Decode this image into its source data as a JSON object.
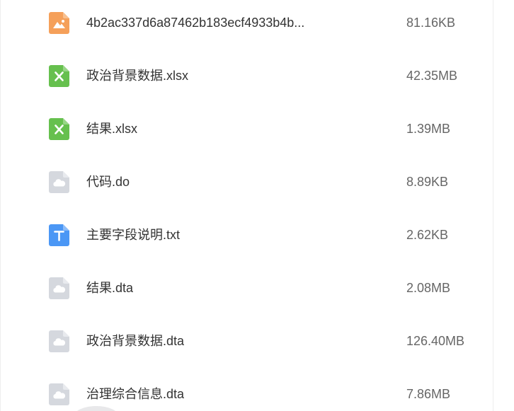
{
  "files": [
    {
      "name": "4b2ac337d6a87462b183ecf4933b4b...",
      "size": "81.16KB",
      "icon": "image-file-icon",
      "icon_color": "#F5A05A"
    },
    {
      "name": "政治背景数据.xlsx",
      "size": "42.35MB",
      "icon": "excel-file-icon",
      "icon_color": "#66C04E"
    },
    {
      "name": "结果.xlsx",
      "size": "1.39MB",
      "icon": "excel-file-icon",
      "icon_color": "#66C04E"
    },
    {
      "name": "代码.do",
      "size": "8.89KB",
      "icon": "unknown-file-icon",
      "icon_color": "#D5D8DE"
    },
    {
      "name": "主要字段说明.txt",
      "size": "2.62KB",
      "icon": "text-file-icon",
      "icon_color": "#4B97F5"
    },
    {
      "name": "结果.dta",
      "size": "2.08MB",
      "icon": "unknown-file-icon",
      "icon_color": "#D5D8DE"
    },
    {
      "name": "政治背景数据.dta",
      "size": "126.40MB",
      "icon": "unknown-file-icon",
      "icon_color": "#D5D8DE"
    },
    {
      "name": "治理综合信息.dta",
      "size": "7.86MB",
      "icon": "unknown-file-icon",
      "icon_color": "#D5D8DE"
    }
  ]
}
